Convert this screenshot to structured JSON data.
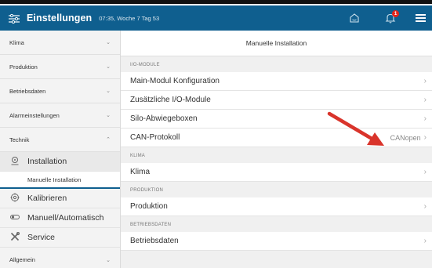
{
  "header": {
    "title": "Einstellungen",
    "subtitle": "07:35, Woche 7 Tag 53",
    "alarm_count": "1",
    "icons": [
      "settings-sliders-icon",
      "home-icon",
      "bell-icon",
      "hamburger-menu-icon"
    ]
  },
  "sidebar": {
    "groups": [
      {
        "label": "Klima",
        "chevron": "⌄"
      },
      {
        "label": "Produktion",
        "chevron": "⌄"
      },
      {
        "label": "Betriebsdaten",
        "chevron": "⌄"
      },
      {
        "label": "Alarmeinstellungen",
        "chevron": "⌄"
      },
      {
        "label": "Technik",
        "chevron": "⌃"
      }
    ],
    "items": [
      {
        "label": "Installation",
        "icon": "installation-icon"
      },
      {
        "label": "Manuelle Installation"
      },
      {
        "label": "Kalibrieren",
        "icon": "calibrate-icon"
      },
      {
        "label": "Manuell/Automatisch",
        "icon": "toggle-icon"
      },
      {
        "label": "Service",
        "icon": "service-tools-icon"
      }
    ],
    "last_group": {
      "label": "Allgemein",
      "chevron": "⌄"
    }
  },
  "main": {
    "title": "Manuelle Installation",
    "sections": [
      {
        "heading": "I/O-MODULE",
        "rows": [
          {
            "label": "Main-Modul Konfiguration",
            "value": ""
          },
          {
            "label": "Zusätzliche I/O-Module",
            "value": ""
          },
          {
            "label": "Silo-Abwiegeboxen",
            "value": ""
          },
          {
            "label": "CAN-Protokoll",
            "value": "CANopen"
          }
        ]
      },
      {
        "heading": "KLIMA",
        "rows": [
          {
            "label": "Klima",
            "value": ""
          }
        ]
      },
      {
        "heading": "PRODUKTION",
        "rows": [
          {
            "label": "Produktion",
            "value": ""
          }
        ]
      },
      {
        "heading": "BETRIEBSDATEN",
        "rows": [
          {
            "label": "Betriebsdaten",
            "value": ""
          }
        ]
      }
    ]
  },
  "colors": {
    "header_bg": "#0f5f8f",
    "accent": "#0f5f8f",
    "alarm_badge": "#e2231a",
    "annotation_arrow": "#d9342b"
  }
}
